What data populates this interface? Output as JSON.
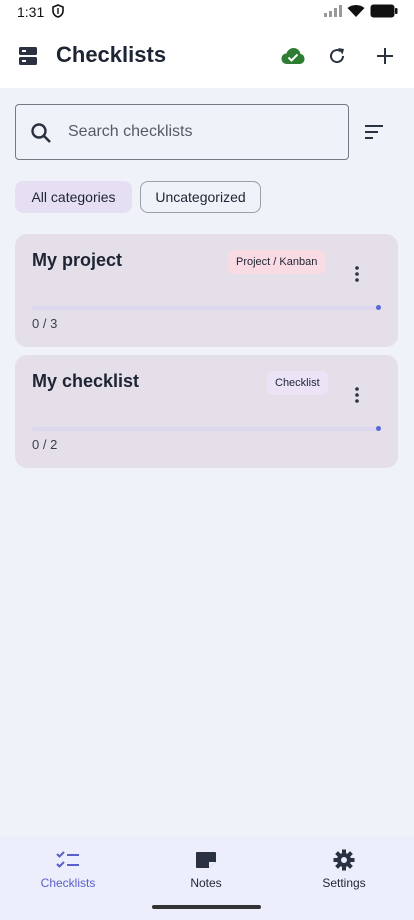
{
  "status_bar": {
    "time": "1:31"
  },
  "app_bar": {
    "title": "Checklists",
    "menu_icon": "view-agenda-icon",
    "actions": [
      "cloud-done-icon",
      "refresh-icon",
      "add-icon"
    ],
    "cloud_color": "#2e7d32"
  },
  "search": {
    "placeholder": "Search checklists",
    "value": ""
  },
  "chips": [
    {
      "label": "All categories",
      "selected": true
    },
    {
      "label": "Uncategorized",
      "selected": false
    }
  ],
  "checklists": [
    {
      "title": "My project",
      "tag": "Project / Kanban",
      "tag_color": "#f9dbe4",
      "count": "0 / 3",
      "progress": 0
    },
    {
      "title": "My checklist",
      "tag": "Checklist",
      "tag_color": "#ece3f7",
      "count": "0 / 2",
      "progress": 0
    }
  ],
  "bottom_nav": [
    {
      "label": "Checklists",
      "icon": "checklist-icon",
      "active": true
    },
    {
      "label": "Notes",
      "icon": "note-icon",
      "active": false
    },
    {
      "label": "Settings",
      "icon": "settings-icon",
      "active": false
    }
  ],
  "colors": {
    "accent": "#5b5fc7",
    "card_bg": "#e5dfe9",
    "background": "#eff2f8"
  }
}
